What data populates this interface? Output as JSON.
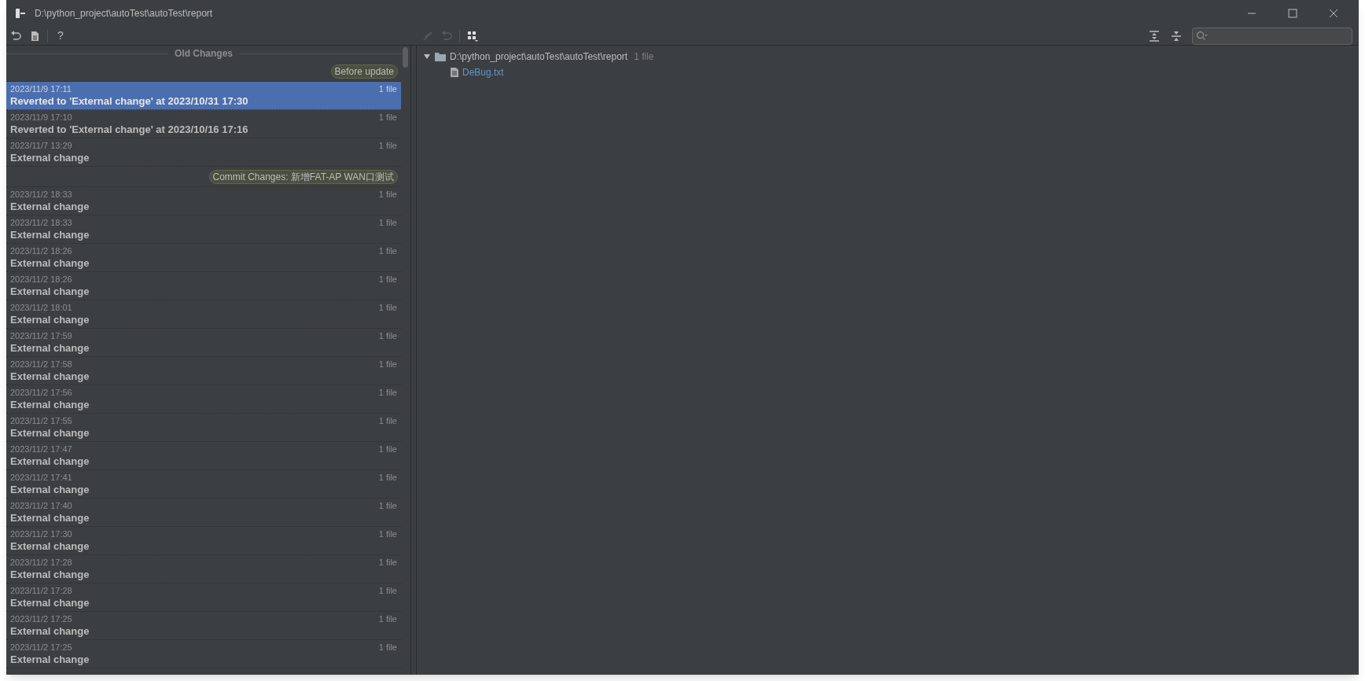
{
  "window": {
    "title": "D:\\python_project\\autoTest\\autoTest\\report"
  },
  "toolbar": {
    "help": "?"
  },
  "history": {
    "header": "Old Changes",
    "groups": [
      {
        "tag": "Before update",
        "rows": [
          {
            "date": "2023/11/9 17:11",
            "title": "Reverted to 'External change' at 2023/10/31 17:30",
            "count": "1 file",
            "selected": true
          },
          {
            "date": "2023/11/9 17:10",
            "title": "Reverted to 'External change' at 2023/10/16 17:16",
            "count": "1 file",
            "selected": false
          },
          {
            "date": "2023/11/7 13:29",
            "title": "External change",
            "count": "1 file",
            "selected": false
          }
        ]
      },
      {
        "tag": "Commit Changes: 新增FAT-AP WAN口测试",
        "rows": [
          {
            "date": "2023/11/2 18:33",
            "title": "External change",
            "count": "1 file",
            "selected": false
          },
          {
            "date": "2023/11/2 18:33",
            "title": "External change",
            "count": "1 file",
            "selected": false
          },
          {
            "date": "2023/11/2 18:26",
            "title": "External change",
            "count": "1 file",
            "selected": false
          },
          {
            "date": "2023/11/2 18:26",
            "title": "External change",
            "count": "1 file",
            "selected": false
          },
          {
            "date": "2023/11/2 18:01",
            "title": "External change",
            "count": "1 file",
            "selected": false
          },
          {
            "date": "2023/11/2 17:59",
            "title": "External change",
            "count": "1 file",
            "selected": false
          },
          {
            "date": "2023/11/2 17:58",
            "title": "External change",
            "count": "1 file",
            "selected": false
          },
          {
            "date": "2023/11/2 17:56",
            "title": "External change",
            "count": "1 file",
            "selected": false
          },
          {
            "date": "2023/11/2 17:55",
            "title": "External change",
            "count": "1 file",
            "selected": false
          },
          {
            "date": "2023/11/2 17:47",
            "title": "External change",
            "count": "1 file",
            "selected": false
          },
          {
            "date": "2023/11/2 17:41",
            "title": "External change",
            "count": "1 file",
            "selected": false
          },
          {
            "date": "2023/11/2 17:40",
            "title": "External change",
            "count": "1 file",
            "selected": false
          },
          {
            "date": "2023/11/2 17:30",
            "title": "External change",
            "count": "1 file",
            "selected": false
          },
          {
            "date": "2023/11/2 17:28",
            "title": "External change",
            "count": "1 file",
            "selected": false
          },
          {
            "date": "2023/11/2 17:28",
            "title": "External change",
            "count": "1 file",
            "selected": false
          },
          {
            "date": "2023/11/2 17:25",
            "title": "External change",
            "count": "1 file",
            "selected": false
          },
          {
            "date": "2023/11/2 17:25",
            "title": "External change",
            "count": "1 file",
            "selected": false
          }
        ]
      }
    ]
  },
  "tree": [
    {
      "name": "D:\\python_project\\autoTest\\autoTest\\report",
      "count": "1 file",
      "expanded": true,
      "children": [
        {
          "name": "DeBug.txt"
        }
      ]
    }
  ]
}
